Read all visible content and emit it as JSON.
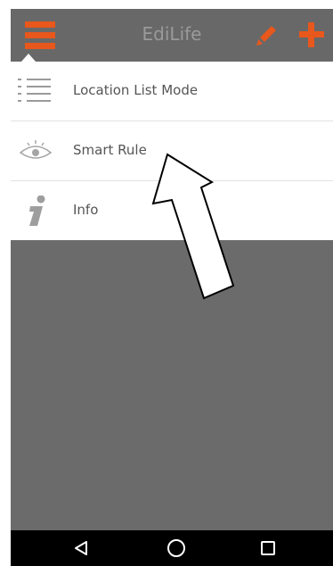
{
  "app_bar": {
    "title": "EdiLife",
    "menu_icon": "hamburger-menu-icon",
    "edit_icon": "pencil-icon",
    "add_icon": "plus-icon",
    "accent_color": "#e8571c"
  },
  "menu": {
    "items": [
      {
        "label": "Location List Mode",
        "icon": "list-icon"
      },
      {
        "label": "Smart Rule",
        "icon": "eye-icon"
      },
      {
        "label": "Info",
        "icon": "info-icon"
      }
    ]
  },
  "nav_bar": {
    "back_icon": "back-triangle-icon",
    "home_icon": "home-circle-icon",
    "recents_icon": "recents-square-icon"
  }
}
